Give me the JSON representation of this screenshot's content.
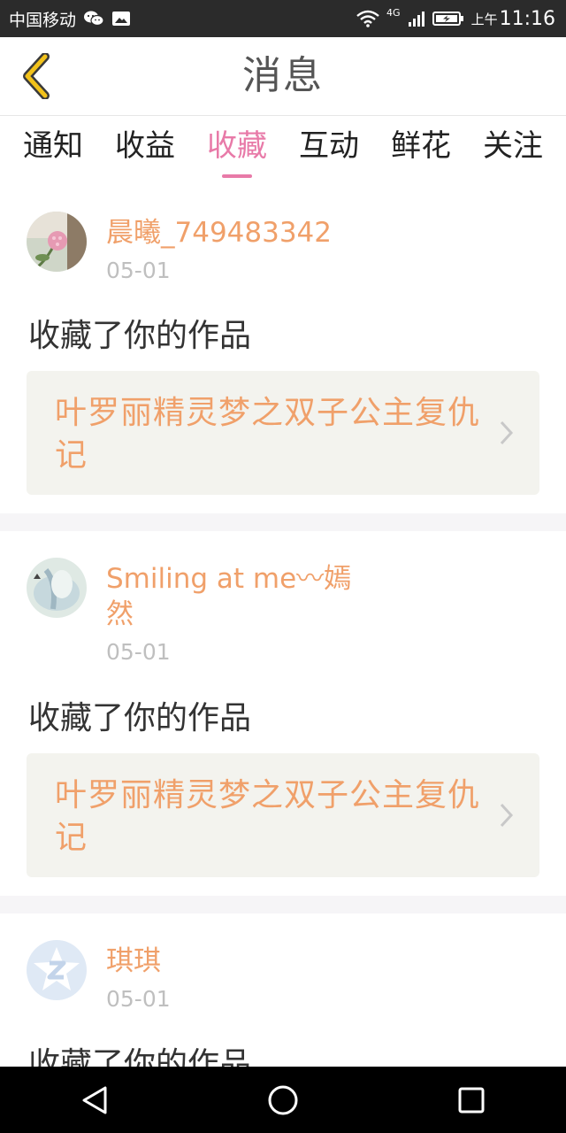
{
  "status_bar": {
    "carrier": "中国移动",
    "network_type": "4G",
    "ampm": "上午",
    "time": "11:16",
    "icons": [
      "wechat-icon",
      "gallery-icon",
      "wifi-icon",
      "signal-icon",
      "battery-icon"
    ]
  },
  "header": {
    "title": "消息",
    "back_icon": "chevron-left-icon"
  },
  "tabs": [
    {
      "label": "通知",
      "active": false
    },
    {
      "label": "收益",
      "active": false
    },
    {
      "label": "收藏",
      "active": true
    },
    {
      "label": "互动",
      "active": false
    },
    {
      "label": "鲜花",
      "active": false
    },
    {
      "label": "关注",
      "active": false
    }
  ],
  "items": [
    {
      "user": "晨曦_749483342",
      "date": "05-01",
      "action": "收藏了你的作品",
      "work_title": "叶罗丽精灵梦之双子公主复仇记"
    },
    {
      "user": "Smiling at me〰嫣然",
      "date": "05-01",
      "action": "收藏了你的作品",
      "work_title": "叶罗丽精灵梦之双子公主复仇记"
    },
    {
      "user": "琪琪",
      "date": "05-01",
      "action": "收藏了你的作品",
      "work_title": ""
    }
  ],
  "nav_bar": {
    "icons": [
      "back-triangle-icon",
      "home-circle-icon",
      "recent-square-icon"
    ]
  },
  "colors": {
    "accent_pink": "#e87aa8",
    "username_orange": "#f0a06a",
    "card_bg": "#f3f3ee",
    "back_arrow_yellow": "#f2c21b"
  }
}
